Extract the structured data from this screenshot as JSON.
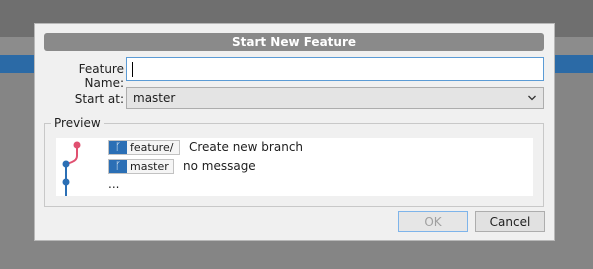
{
  "dialog": {
    "title": "Start New Feature",
    "feature_name_label": "Feature Name:",
    "feature_name_value": "",
    "start_at_label": "Start at:",
    "start_at_value": "master",
    "preview_label": "Preview",
    "preview": {
      "new_branch": "feature/",
      "new_branch_message": "Create new branch",
      "base_branch": "master",
      "base_branch_message": "no message",
      "more": "..."
    },
    "ok_label": "OK",
    "cancel_label": "Cancel"
  },
  "colors": {
    "accent_blue": "#2b6fb5",
    "new_commit_pink": "#e05070",
    "title_bar": "#8a8a8a"
  },
  "icons": {
    "branch_badge": "branch-icon",
    "dropdown": "chevron-down-icon"
  }
}
